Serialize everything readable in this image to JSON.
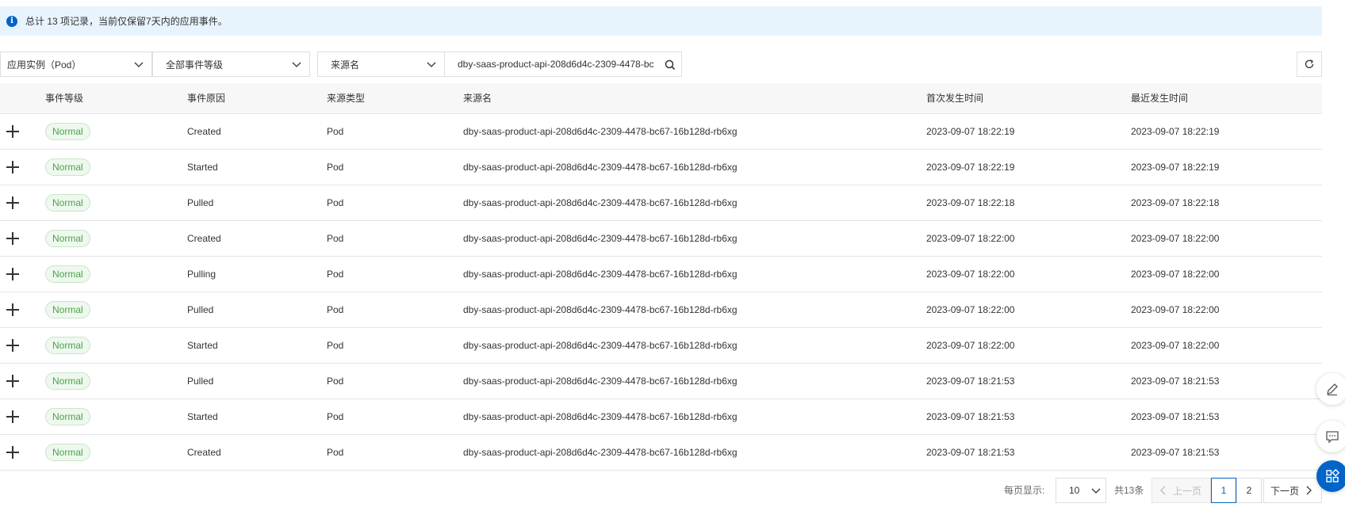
{
  "info": {
    "text": "总计 13 项记录，当前仅保留7天内的应用事件。",
    "icon": "info-icon"
  },
  "filters": {
    "instance_type": "应用实例（Pod）",
    "event_level": "全部事件等级",
    "source_field": "来源名",
    "search_value": "dby-saas-product-api-208d6d4c-2309-4478-bc"
  },
  "table": {
    "headers": [
      "事件等级",
      "事件原因",
      "来源类型",
      "来源名",
      "首次发生时间",
      "最近发生时间"
    ],
    "rows": [
      {
        "level": "Normal",
        "reason": "Created",
        "source_type": "Pod",
        "source_name": "dby-saas-product-api-208d6d4c-2309-4478-bc67-16b128d-rb6xg",
        "first_time": "2023-09-07 18:22:19",
        "last_time": "2023-09-07 18:22:19"
      },
      {
        "level": "Normal",
        "reason": "Started",
        "source_type": "Pod",
        "source_name": "dby-saas-product-api-208d6d4c-2309-4478-bc67-16b128d-rb6xg",
        "first_time": "2023-09-07 18:22:19",
        "last_time": "2023-09-07 18:22:19"
      },
      {
        "level": "Normal",
        "reason": "Pulled",
        "source_type": "Pod",
        "source_name": "dby-saas-product-api-208d6d4c-2309-4478-bc67-16b128d-rb6xg",
        "first_time": "2023-09-07 18:22:18",
        "last_time": "2023-09-07 18:22:18"
      },
      {
        "level": "Normal",
        "reason": "Created",
        "source_type": "Pod",
        "source_name": "dby-saas-product-api-208d6d4c-2309-4478-bc67-16b128d-rb6xg",
        "first_time": "2023-09-07 18:22:00",
        "last_time": "2023-09-07 18:22:00"
      },
      {
        "level": "Normal",
        "reason": "Pulling",
        "source_type": "Pod",
        "source_name": "dby-saas-product-api-208d6d4c-2309-4478-bc67-16b128d-rb6xg",
        "first_time": "2023-09-07 18:22:00",
        "last_time": "2023-09-07 18:22:00"
      },
      {
        "level": "Normal",
        "reason": "Pulled",
        "source_type": "Pod",
        "source_name": "dby-saas-product-api-208d6d4c-2309-4478-bc67-16b128d-rb6xg",
        "first_time": "2023-09-07 18:22:00",
        "last_time": "2023-09-07 18:22:00"
      },
      {
        "level": "Normal",
        "reason": "Started",
        "source_type": "Pod",
        "source_name": "dby-saas-product-api-208d6d4c-2309-4478-bc67-16b128d-rb6xg",
        "first_time": "2023-09-07 18:22:00",
        "last_time": "2023-09-07 18:22:00"
      },
      {
        "level": "Normal",
        "reason": "Pulled",
        "source_type": "Pod",
        "source_name": "dby-saas-product-api-208d6d4c-2309-4478-bc67-16b128d-rb6xg",
        "first_time": "2023-09-07 18:21:53",
        "last_time": "2023-09-07 18:21:53"
      },
      {
        "level": "Normal",
        "reason": "Started",
        "source_type": "Pod",
        "source_name": "dby-saas-product-api-208d6d4c-2309-4478-bc67-16b128d-rb6xg",
        "first_time": "2023-09-07 18:21:53",
        "last_time": "2023-09-07 18:21:53"
      },
      {
        "level": "Normal",
        "reason": "Created",
        "source_type": "Pod",
        "source_name": "dby-saas-product-api-208d6d4c-2309-4478-bc67-16b128d-rb6xg",
        "first_time": "2023-09-07 18:21:53",
        "last_time": "2023-09-07 18:21:53"
      }
    ]
  },
  "pagination": {
    "page_size_label": "每页显示:",
    "page_size": "10",
    "total": "共13条",
    "prev": "上一页",
    "pages": [
      "1",
      "2"
    ],
    "current_page": "1",
    "next": "下一页"
  },
  "floating": [
    "edit-icon",
    "feedback-icon",
    "apps-icon"
  ],
  "colors": {
    "accent": "#0064c8",
    "info_bg": "#e8f4fd",
    "badge_text": "#4ca24c",
    "badge_bg": "#eef8ee"
  }
}
